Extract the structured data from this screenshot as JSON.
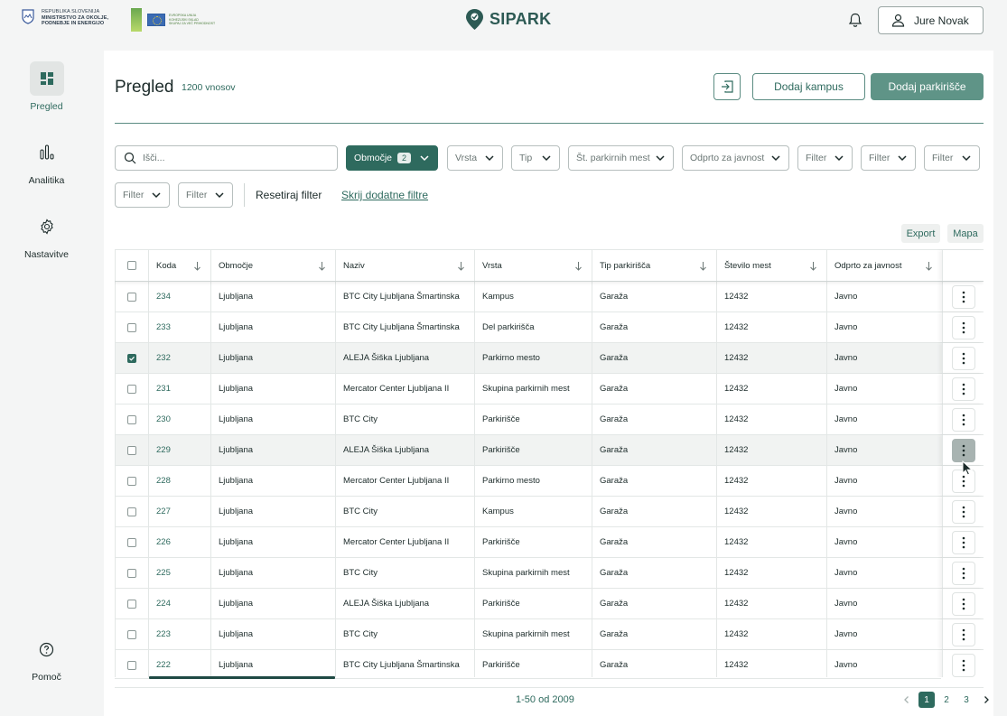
{
  "header": {
    "gov_lines": [
      "REPUBLIKA SLOVENIJA",
      "MINISTRSTVO ZA OKOLJE,",
      "PODNEBJE IN ENERGIJO"
    ],
    "eu_lines": [
      "EVROPSKA UNIJA",
      "KOHEZIJSKI SKLAD",
      "SKUPAJ ZA VEČ PRIHODNOST"
    ],
    "brand": "SIPARK",
    "user_name": "Jure Novak"
  },
  "sidebar": {
    "items": [
      {
        "label": "Pregled",
        "icon": "dashboard-icon",
        "active": true
      },
      {
        "label": "Analitika",
        "icon": "bar-chart-icon",
        "active": false
      },
      {
        "label": "Nastavitve",
        "icon": "gear-icon",
        "active": false
      }
    ],
    "help_label": "Pomoč"
  },
  "page": {
    "title": "Pregled",
    "count": "1200 vnosov",
    "add_campus": "Dodaj kampus",
    "add_parking": "Dodaj parkirišče"
  },
  "filters": {
    "search_placeholder": "Išči...",
    "area_label": "Območje",
    "area_badge": "2",
    "type_kind": "Vrsta",
    "type": "Tip",
    "spaces": "Št. parkirnih mest",
    "public": "Odprto za javnost",
    "filter": "Filter",
    "reset": "Resetiraj filter",
    "hide_extra": "Skrij dodatne filtre"
  },
  "table_actions": {
    "export": "Export",
    "map": "Mapa"
  },
  "table": {
    "columns": [
      "Koda",
      "Območje",
      "Naziv",
      "Vrsta",
      "Tip parkirišča",
      "Število mest",
      "Odprto za javnost"
    ],
    "rows": [
      {
        "code": "234",
        "area": "Ljubljana",
        "name": "BTC City Ljubljana Šmartinska",
        "kind": "Kampus",
        "type": "Garaža",
        "spaces": "12432",
        "public": "Javno",
        "checked": false
      },
      {
        "code": "233",
        "area": "Ljubljana",
        "name": "BTC City Ljubljana Šmartinska",
        "kind": "Del parkirišča",
        "type": "Garaža",
        "spaces": "12432",
        "public": "Javno",
        "checked": false
      },
      {
        "code": "232",
        "area": "Ljubljana",
        "name": "ALEJA Šiška Ljubljana",
        "kind": "Parkirno mesto",
        "type": "Garaža",
        "spaces": "12432",
        "public": "Javno",
        "checked": true
      },
      {
        "code": "231",
        "area": "Ljubljana",
        "name": "Mercator Center Ljubljana II",
        "kind": "Skupina parkirnih mest",
        "type": "Garaža",
        "spaces": "12432",
        "public": "Javno",
        "checked": false
      },
      {
        "code": "230",
        "area": "Ljubljana",
        "name": "BTC City",
        "kind": "Parkirišče",
        "type": "Garaža",
        "spaces": "12432",
        "public": "Javno",
        "checked": false
      },
      {
        "code": "229",
        "area": "Ljubljana",
        "name": "ALEJA Šiška Ljubljana",
        "kind": "Parkirišče",
        "type": "Garaža",
        "spaces": "12432",
        "public": "Javno",
        "checked": false,
        "hover": true
      },
      {
        "code": "228",
        "area": "Ljubljana",
        "name": "Mercator Center Ljubljana II",
        "kind": "Parkirno mesto",
        "type": "Garaža",
        "spaces": "12432",
        "public": "Javno",
        "checked": false
      },
      {
        "code": "227",
        "area": "Ljubljana",
        "name": "BTC City",
        "kind": "Kampus",
        "type": "Garaža",
        "spaces": "12432",
        "public": "Javno",
        "checked": false
      },
      {
        "code": "226",
        "area": "Ljubljana",
        "name": "Mercator Center Ljubljana II",
        "kind": "Parkirišče",
        "type": "Garaža",
        "spaces": "12432",
        "public": "Javno",
        "checked": false
      },
      {
        "code": "225",
        "area": "Ljubljana",
        "name": "BTC City",
        "kind": "Skupina parkirnih mest",
        "type": "Garaža",
        "spaces": "12432",
        "public": "Javno",
        "checked": false
      },
      {
        "code": "224",
        "area": "Ljubljana",
        "name": "ALEJA Šiška Ljubljana",
        "kind": "Parkirišče",
        "type": "Garaža",
        "spaces": "12432",
        "public": "Javno",
        "checked": false
      },
      {
        "code": "223",
        "area": "Ljubljana",
        "name": "BTC City",
        "kind": "Skupina parkirnih mest",
        "type": "Garaža",
        "spaces": "12432",
        "public": "Javno",
        "checked": false
      },
      {
        "code": "222",
        "area": "Ljubljana",
        "name": "BTC City Ljubljana Šmartinska",
        "kind": "Parkirišče",
        "type": "Garaža",
        "spaces": "12432",
        "public": "Javno",
        "checked": false
      }
    ]
  },
  "pagination": {
    "range": "1-50 od 2009",
    "pages": [
      "1",
      "2",
      "3"
    ],
    "current": "1"
  },
  "colors": {
    "brand": "#2e6a5e",
    "primary_button": "#5f9487"
  }
}
